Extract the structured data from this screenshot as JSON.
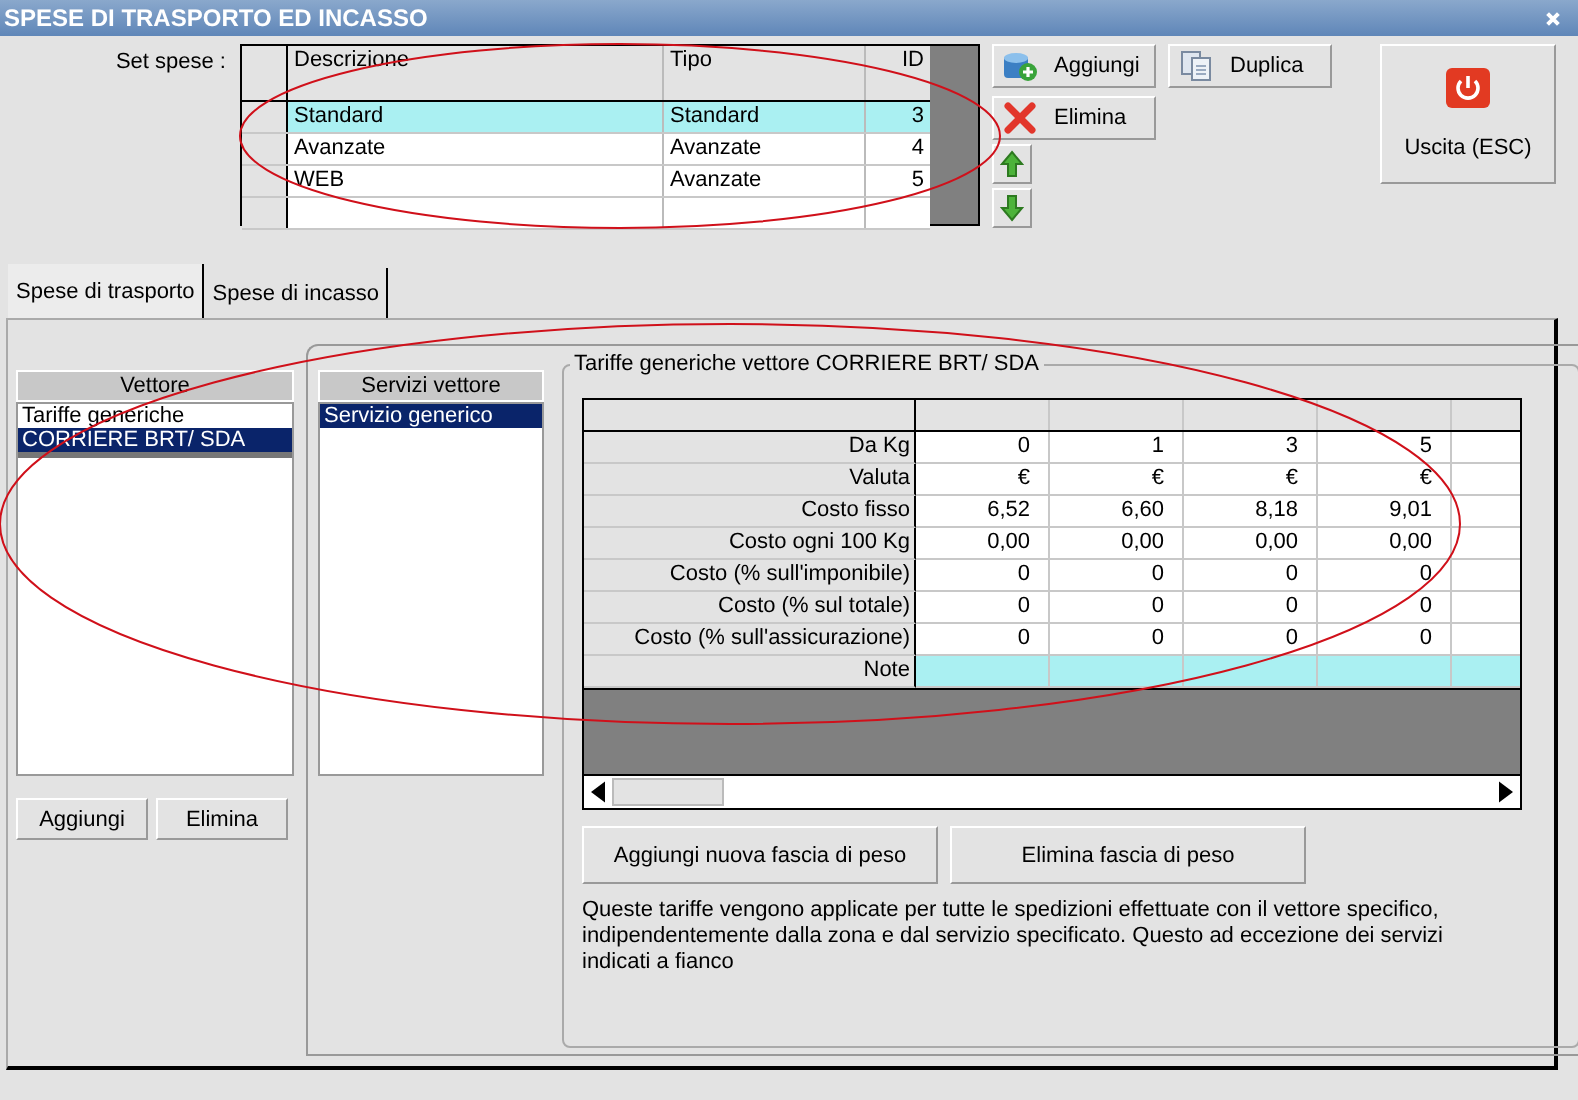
{
  "window": {
    "title": "SPESE DI TRASPORTO ED INCASSO"
  },
  "set_spese": {
    "label": "Set spese :",
    "columns": [
      "Descrizione",
      "Tipo",
      "ID"
    ],
    "rows": [
      {
        "descrizione": "Standard",
        "tipo": "Standard",
        "id": "3",
        "selected": true
      },
      {
        "descrizione": "Avanzate",
        "tipo": "Avanzate",
        "id": "4",
        "selected": false
      },
      {
        "descrizione": "WEB",
        "tipo": "Avanzate",
        "id": "5",
        "selected": false
      }
    ]
  },
  "set_buttons": [
    {
      "kind": "add",
      "label": "Aggiungi"
    },
    {
      "kind": "duplicate",
      "label": "Duplica"
    },
    {
      "kind": "delete",
      "label": "Elimina"
    },
    {
      "kind": "up"
    },
    {
      "kind": "down"
    }
  ],
  "exit_button": {
    "label": "Uscita (ESC)"
  },
  "tabs": [
    {
      "label": "Spese di trasporto",
      "selected": true
    },
    {
      "label": "Spese di incasso",
      "selected": false
    }
  ],
  "vettore": {
    "header": "Vettore",
    "items": [
      {
        "label": "Tariffe generiche",
        "selected": false
      },
      {
        "label": "CORRIERE BRT/ SDA",
        "selected": true
      }
    ],
    "buttons": [
      "Aggiungi",
      "Elimina"
    ]
  },
  "servizi": {
    "header": "Servizi vettore",
    "items": [
      {
        "label": "Servizio generico",
        "selected": true
      }
    ]
  },
  "tariffe": {
    "title": "Tariffe generiche vettore CORRIERE BRT/ SDA",
    "rows": [
      {
        "kind": "value",
        "label": "Da Kg",
        "values": [
          "0",
          "1",
          "3",
          "5"
        ]
      },
      {
        "kind": "value",
        "label": "Valuta",
        "values": [
          "€",
          "€",
          "€",
          "€"
        ]
      },
      {
        "kind": "value",
        "label": "Costo fisso",
        "values": [
          "6,52",
          "6,60",
          "8,18",
          "9,01"
        ]
      },
      {
        "kind": "value",
        "label": "Costo ogni 100 Kg",
        "values": [
          "0,00",
          "0,00",
          "0,00",
          "0,00"
        ]
      },
      {
        "kind": "value",
        "label": "Costo (% sull'imponibile)",
        "values": [
          "0",
          "0",
          "0",
          "0"
        ]
      },
      {
        "kind": "value",
        "label": "Costo (% sul totale)",
        "values": [
          "0",
          "0",
          "0",
          "0"
        ]
      },
      {
        "kind": "value",
        "label": "Costo (% sull'assicurazione)",
        "values": [
          "0",
          "0",
          "0",
          "0"
        ]
      },
      {
        "kind": "note",
        "label": "Note",
        "values": []
      }
    ],
    "buttons": [
      "Aggiungi nuova fascia di peso",
      "Elimina fascia di peso"
    ],
    "description": "Queste tariffe vengono applicate per tutte le spedizioni effettuate con il vettore specifico, indipendentemente dalla zona e dal servizio specificato. Questo ad eccezione dei servizi indicati a fianco"
  }
}
